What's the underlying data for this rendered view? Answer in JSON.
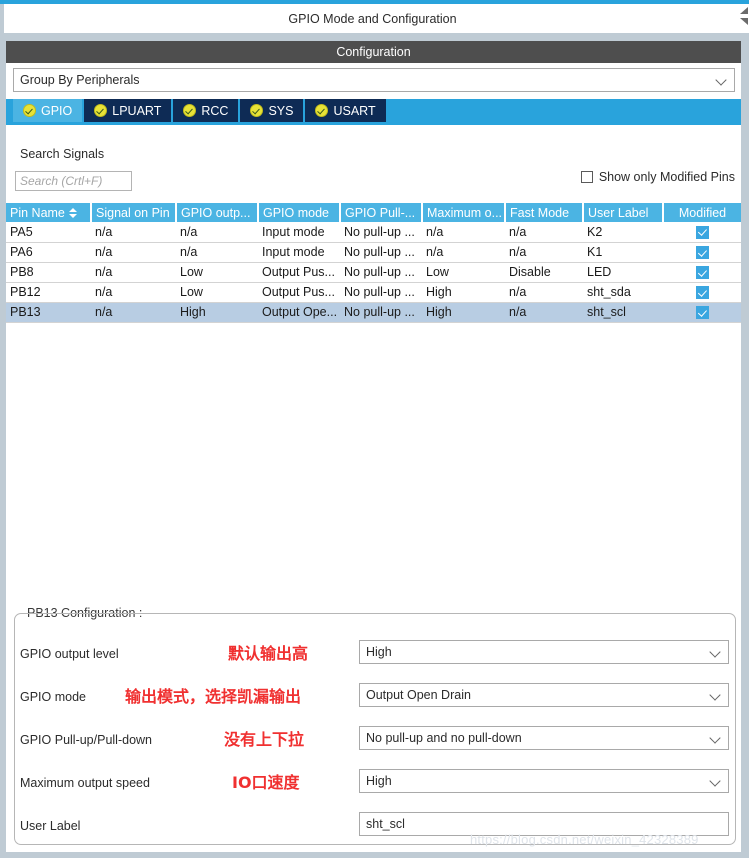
{
  "window": {
    "title": "GPIO Mode and Configuration",
    "section_header": "Configuration"
  },
  "group_by": {
    "value": "Group By Peripherals",
    "arrow_icon": "chevron-down-icon"
  },
  "tabs": [
    {
      "label": "GPIO",
      "active": true,
      "status_icon": "check-circle-icon"
    },
    {
      "label": "LPUART",
      "active": false,
      "status_icon": "check-circle-icon"
    },
    {
      "label": "RCC",
      "active": false,
      "status_icon": "check-circle-icon"
    },
    {
      "label": "SYS",
      "active": false,
      "status_icon": "check-circle-icon"
    },
    {
      "label": "USART",
      "active": false,
      "status_icon": "check-circle-icon"
    }
  ],
  "search": {
    "label": "Search Signals",
    "placeholder": "Search (Crtl+F)",
    "value": ""
  },
  "show_modified": {
    "label": "Show only Modified Pins",
    "checked": false
  },
  "table": {
    "columns": [
      "Pin Name",
      "Signal on Pin",
      "GPIO outp...",
      "GPIO mode",
      "GPIO Pull-...",
      "Maximum o...",
      "Fast Mode",
      "User Label",
      "Modified"
    ],
    "sort_column": "Pin Name",
    "sort_icon": "sort-updown-icon",
    "rows": [
      {
        "pin_name": "PA5",
        "signal_on_pin": "n/a",
        "gpio_output": "n/a",
        "gpio_mode": "Input mode",
        "gpio_pull": "No pull-up ...",
        "max_output": "n/a",
        "fast_mode": "n/a",
        "user_label": "K2",
        "modified": true,
        "selected": false
      },
      {
        "pin_name": "PA6",
        "signal_on_pin": "n/a",
        "gpio_output": "n/a",
        "gpio_mode": "Input mode",
        "gpio_pull": "No pull-up ...",
        "max_output": "n/a",
        "fast_mode": "n/a",
        "user_label": "K1",
        "modified": true,
        "selected": false
      },
      {
        "pin_name": "PB8",
        "signal_on_pin": "n/a",
        "gpio_output": "Low",
        "gpio_mode": "Output Pus...",
        "gpio_pull": "No pull-up ...",
        "max_output": "Low",
        "fast_mode": "Disable",
        "user_label": "LED",
        "modified": true,
        "selected": false
      },
      {
        "pin_name": "PB12",
        "signal_on_pin": "n/a",
        "gpio_output": "Low",
        "gpio_mode": "Output Pus...",
        "gpio_pull": "No pull-up ...",
        "max_output": "High",
        "fast_mode": "n/a",
        "user_label": "sht_sda",
        "modified": true,
        "selected": false
      },
      {
        "pin_name": "PB13",
        "signal_on_pin": "n/a",
        "gpio_output": "High",
        "gpio_mode": "Output Ope...",
        "gpio_pull": "No pull-up ...",
        "max_output": "High",
        "fast_mode": "n/a",
        "user_label": "sht_scl",
        "modified": true,
        "selected": true
      }
    ]
  },
  "pin_config": {
    "legend": "PB13 Configuration :",
    "fields": [
      {
        "label": "GPIO output level",
        "value": "High",
        "note": "默认输出高"
      },
      {
        "label": "GPIO mode",
        "value": "Output Open Drain",
        "note": "输出模式，选择凯漏输出"
      },
      {
        "label": "GPIO Pull-up/Pull-down",
        "value": "No pull-up and no pull-down",
        "note": "没有上下拉"
      },
      {
        "label": "Maximum output speed",
        "value": "High",
        "note": "IO口速度"
      },
      {
        "label": "User Label",
        "value": "sht_scl",
        "note": ""
      }
    ]
  },
  "watermark": "https://blog.csdn.net/weixin_42328389",
  "colors": {
    "accent": "#29a3dc",
    "tab_active": "#4bb4e3",
    "tab_inactive": "#0e2b55",
    "header_bar": "#4e4e4e",
    "table_header": "#4bb4e3",
    "row_selected": "#b8cde3",
    "note_red": "#f03030",
    "checkbox_blue": "#3aa6e0"
  }
}
